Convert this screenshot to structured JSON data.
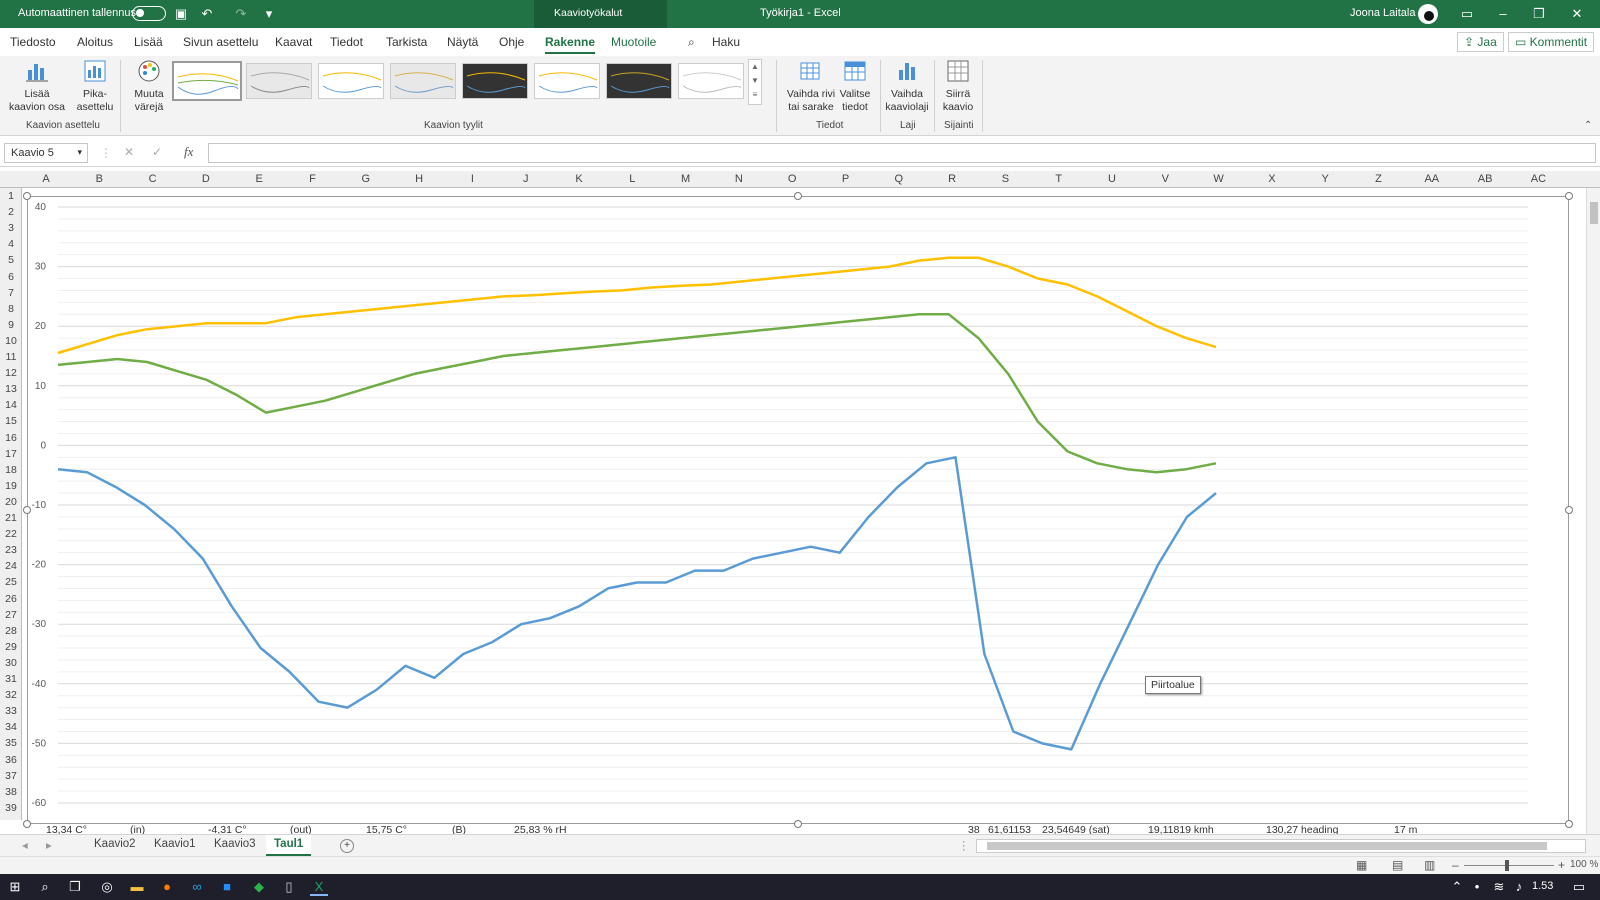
{
  "titlebar": {
    "autosave_label": "Automaattinen tallennus",
    "tools_label": "Kaaviotyökalut",
    "doc_title": "Työkirja1  -  Excel",
    "user": "Joona Laitala"
  },
  "menu": {
    "items": [
      "Tiedosto",
      "Aloitus",
      "Lisää",
      "Sivun asettelu",
      "Kaavat",
      "Tiedot",
      "Tarkista",
      "Näytä",
      "Ohje",
      "Rakenne",
      "Muotoile"
    ],
    "search": "Haku",
    "share": "Jaa",
    "comments": "Kommentit"
  },
  "ribbon": {
    "add_element": "Lisää kaavion osa",
    "quick_layout": "Pika-asettelu",
    "change_colors": "Muuta värejä",
    "group_layout": "Kaavion asettelu",
    "group_styles": "Kaavion tyylit",
    "switch_row_col": "Vaihda rivi tai sarake",
    "select_data": "Valitse tiedot",
    "group_data": "Tiedot",
    "change_type": "Vaihda kaaviolaji",
    "group_type": "Laji",
    "move_chart": "Siirrä kaavio",
    "group_location": "Sijainti"
  },
  "formula": {
    "namebox": "Kaavio 5",
    "fx": "fx"
  },
  "columns": [
    "A",
    "B",
    "C",
    "D",
    "E",
    "F",
    "G",
    "H",
    "I",
    "J",
    "K",
    "L",
    "M",
    "N",
    "O",
    "P",
    "Q",
    "R",
    "S",
    "T",
    "U",
    "V",
    "W",
    "X",
    "Y",
    "Z",
    "AA",
    "AB",
    "AC"
  ],
  "rows": [
    "1",
    "2",
    "3",
    "4",
    "5",
    "6",
    "7",
    "8",
    "9",
    "10",
    "11",
    "12",
    "13",
    "14",
    "15",
    "16",
    "17",
    "18",
    "19",
    "20",
    "21",
    "22",
    "23",
    "24",
    "25",
    "26",
    "27",
    "28",
    "29",
    "30",
    "31",
    "32",
    "33",
    "34",
    "35",
    "36",
    "37",
    "38",
    "39"
  ],
  "tooltip": "Piirtoalue",
  "row39_cells": [
    "13,34 C°",
    "(in)",
    "-4,31 C°",
    "(out)",
    "15,75 C°",
    "(B)",
    "25,83 % rH",
    "38",
    "61,61153",
    "23,54649 (sat)",
    "19,11819 kmh",
    "130,27 heading",
    "17 m"
  ],
  "sheets": [
    "Kaavio2",
    "Kaavio1",
    "Kaavio3",
    "Taul1"
  ],
  "status": {
    "zoom": "100 %"
  },
  "taskbar": {
    "time": "1.53"
  },
  "chart_data": {
    "type": "line",
    "ylim": [
      -60,
      40
    ],
    "yticks": [
      40,
      30,
      20,
      10,
      0,
      -10,
      -20,
      -30,
      -40,
      -50,
      -60
    ],
    "grid": true,
    "series": [
      {
        "color": "#FFC000",
        "values": [
          15.5,
          17,
          18.5,
          19.5,
          20,
          20.5,
          20.5,
          20.5,
          21.5,
          22,
          22.5,
          23,
          23.5,
          24,
          24.5,
          25,
          25.2,
          25.5,
          25.8,
          26,
          26.5,
          26.8,
          27,
          27.5,
          28,
          28.5,
          29,
          29.5,
          30,
          31,
          31.5,
          31.5,
          30,
          28,
          27,
          25,
          22.5,
          20,
          18,
          16.5
        ]
      },
      {
        "color": "#70AD47",
        "values": [
          13.5,
          14,
          14.5,
          14,
          12.5,
          11,
          8.5,
          5.5,
          6.5,
          7.5,
          9,
          10.5,
          12,
          13,
          14,
          15,
          15.5,
          16,
          16.5,
          17,
          17.5,
          18,
          18.5,
          19,
          19.5,
          20,
          20.5,
          21,
          21.5,
          22,
          22,
          18,
          12,
          4,
          -1,
          -3,
          -4,
          -4.5,
          -4,
          -3
        ]
      },
      {
        "color": "#5B9BD5",
        "values": [
          -4,
          -4.5,
          -7,
          -10,
          -14,
          -19,
          -27,
          -34,
          -38,
          -43,
          -44,
          -41,
          -37,
          -39,
          -35,
          -33,
          -30,
          -29,
          -27,
          -24,
          -23,
          -23,
          -21,
          -21,
          -19,
          -18,
          -17,
          -18,
          -12,
          -7,
          -3,
          -2,
          -35,
          -48,
          -50,
          -51,
          -40,
          -30,
          -20,
          -12,
          -8
        ]
      }
    ]
  }
}
